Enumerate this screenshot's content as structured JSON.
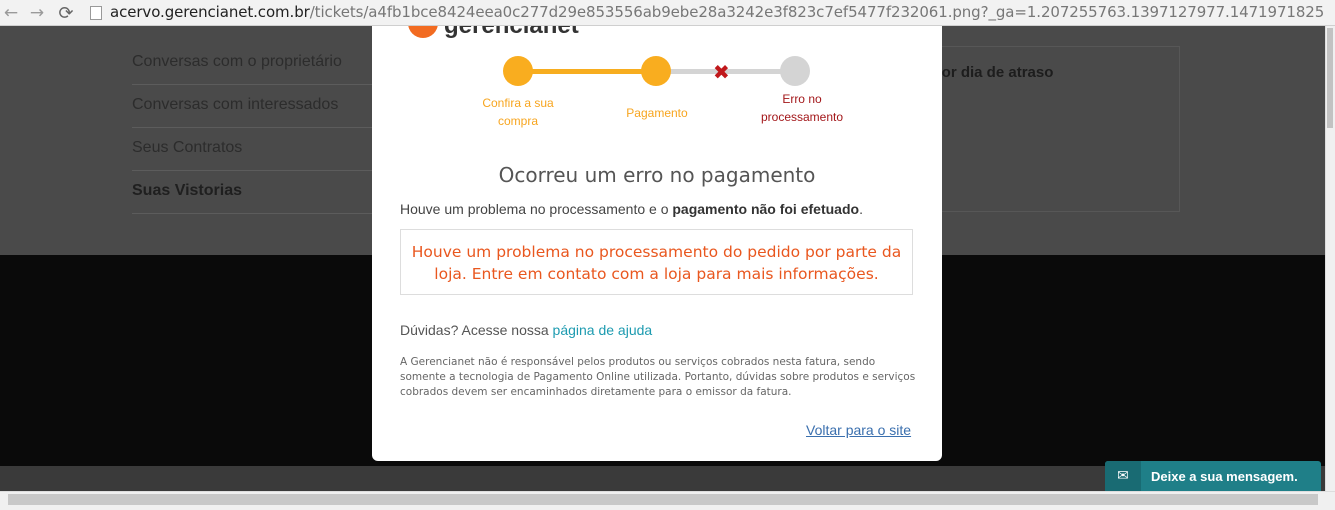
{
  "browser": {
    "url_host": "acervo.gerencianet.com.br",
    "url_path": "/tickets/a4fb1bce8424eea0c277d29e853556ab9ebe28a3242e3f823c7ef5477f232061.png?_ga=1.207255763.1397127977.1471971825",
    "back_icon": "←",
    "forward_icon": "→",
    "reload_icon": "⟳"
  },
  "background": {
    "menu": [
      {
        "label": "Conversas com o proprietário"
      },
      {
        "label": "Conversas com interessados"
      },
      {
        "label": "Seus Contratos"
      },
      {
        "label": "Suas Vistorias"
      }
    ],
    "panel_text": "a por dia de atraso"
  },
  "modal": {
    "logo_text": "gerencianet",
    "steps": {
      "step1": "Confira a sua compra",
      "step2": "Pagamento",
      "step3": "Erro no processamento",
      "error_mark": "✖"
    },
    "title": "Ocorreu um erro no pagamento",
    "description_prefix": "Houve um problema no processamento e o ",
    "description_bold": "pagamento não foi efetuado",
    "description_suffix": ".",
    "error_message": "Houve um problema no processamento do pedido por parte da loja. Entre em contato com a loja para mais informações.",
    "help_prefix": "Dúvidas? Acesse nossa ",
    "help_link": "página de ajuda",
    "disclaimer": "A Gerencianet não é responsável pelos produtos ou serviços cobrados nesta fatura, sendo somente a tecnologia de Pagamento Online utilizada. Portanto, dúvidas sobre produtos e serviços cobrados devem ser encaminhados diretamente para o emissor da fatura.",
    "back_link": "Voltar para o site"
  },
  "chat": {
    "icon": "✉",
    "label": "Deixe a sua mensagem."
  },
  "colors": {
    "accent": "#f9ad1f",
    "error": "#e9571f",
    "link": "#1d9bb0",
    "chat": "#1f7f88"
  }
}
